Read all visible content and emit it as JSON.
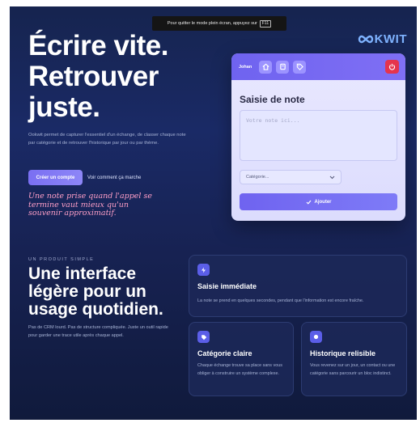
{
  "fullscreen_banner": {
    "text": "Pour quitter le mode plein écran, appuyez sur",
    "key": "F11"
  },
  "brand": {
    "logo_text": "KWIT"
  },
  "hero": {
    "title": "Écrire vite. Retrouver juste.",
    "description": "Ookwit permet de capturer l'essentiel d'un échange, de classer chaque note par catégorie et de retrouver l'historique par jour ou par thème.",
    "cta_primary": "Créer un compte",
    "cta_secondary": "Voir comment ça marche",
    "quote": "Une note prise quand l'appel se termine vaut mieux qu'un souvenir approximatif."
  },
  "app_card": {
    "user": "Johan",
    "nav_icons": [
      "home-icon",
      "book-icon",
      "tag-icon"
    ],
    "power_icon": "power-icon",
    "title": "Saisie de note",
    "note_placeholder": "Votre note ici...",
    "category_label": "Catégorie...",
    "add_button": "Ajouter"
  },
  "section": {
    "eyebrow": "UN PRODUIT SIMPLE",
    "title": "Une interface légère pour un usage quotidien.",
    "description": "Pas de CRM lourd. Pas de structure compliquée. Juste un outil rapide pour garder une trace utile après chaque appel."
  },
  "features": [
    {
      "icon": "bolt-icon",
      "title": "Saisie immédiate",
      "text": "La note se prend en quelques secondes, pendant que l'information est encore fraîche."
    },
    {
      "icon": "tag-icon",
      "title": "Catégorie claire",
      "text": "Chaque échange trouve sa place sans vous obliger à construire un système complexe."
    },
    {
      "icon": "circle-icon",
      "title": "Historique relisible",
      "text": "Vous revenez sur un jour, un contact ou une catégorie sans parcourir un bloc indistinct."
    }
  ],
  "colors": {
    "accent": "#6f63f0",
    "danger": "#e5344d",
    "quote": "#ff9fc7",
    "logo": "#7fb3ff"
  }
}
